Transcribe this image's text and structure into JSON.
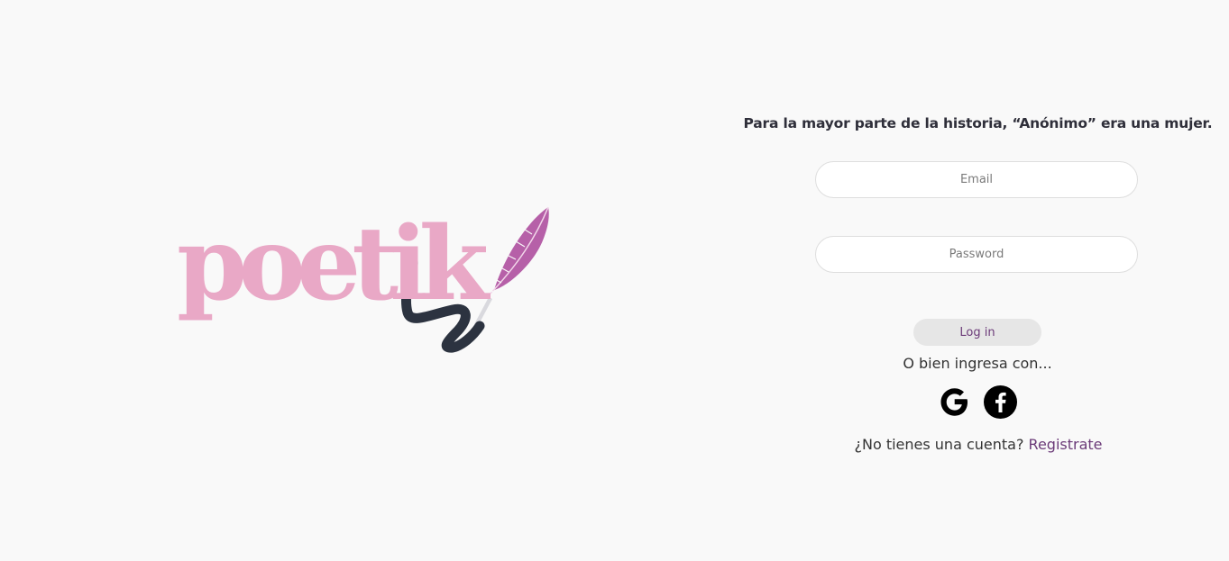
{
  "brand": {
    "logo_text": "poetik",
    "logo_icon": "quill-feather-icon",
    "colors": {
      "logo_pink": "#e9a8c6",
      "feather": "#b660a8",
      "ink_stroke": "#2c3340"
    }
  },
  "login": {
    "tagline": "Para la mayor parte de la historia, “Anónimo” era una mujer.",
    "email_placeholder": "Email",
    "password_placeholder": "Password",
    "login_button": "Log in",
    "alt_login_text": "O bien ingresa con...",
    "social": [
      {
        "name": "google",
        "icon": "google-icon"
      },
      {
        "name": "facebook",
        "icon": "facebook-icon"
      }
    ],
    "no_account_text": "¿No tienes una cuenta?",
    "register_link": "Registrate",
    "colors": {
      "accent": "#6b3a78",
      "button_bg": "#e6e6e6",
      "page_bg": "#f9f9f9"
    }
  }
}
